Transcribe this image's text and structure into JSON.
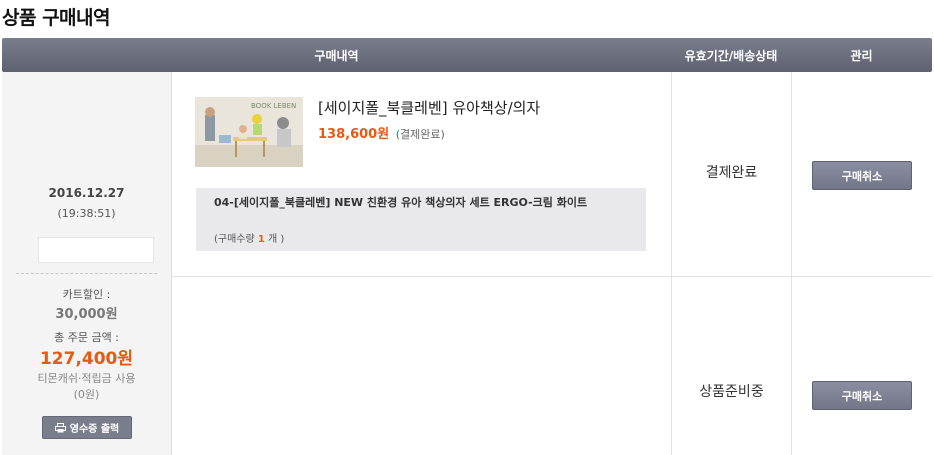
{
  "page_title": "상품 구매내역",
  "table_header": {
    "purchase": "구매내역",
    "status": "유효기간/배송상태",
    "manage": "관리"
  },
  "order": {
    "date": "2016.12.27",
    "time": "(19:38:51)",
    "cart_discount_label": "카트할인 :",
    "cart_discount_value": "30,000원",
    "total_label": "총 주문 금액 :",
    "total_value": "127,400원",
    "point_label": "티몬캐쉬·적립금 사용",
    "point_value": "(0원)",
    "receipt_button": "영수증 출력"
  },
  "item": {
    "image_text": "BOOK LEBEN",
    "title": "[세이지폴_북클레벤] 유아책상/의자",
    "price": "138,600원",
    "pay_status": "(결제완료)",
    "option_name": "04-[세이지폴_북클레벤] NEW 친환경 유아 책상의자 세트 ERGO-크림 화이트",
    "qty_prefix": "(구매수량 ",
    "qty_value": "1",
    "qty_suffix": " 개 )"
  },
  "rows": [
    {
      "status": "결제완료",
      "cancel_label": "구매취소"
    },
    {
      "status": "상품준비중",
      "cancel_label": "구매취소"
    }
  ],
  "colors": {
    "accent_orange": "#e75a13",
    "header_bg": "#6b6f7d",
    "button_bg": "#7a7e8f"
  }
}
